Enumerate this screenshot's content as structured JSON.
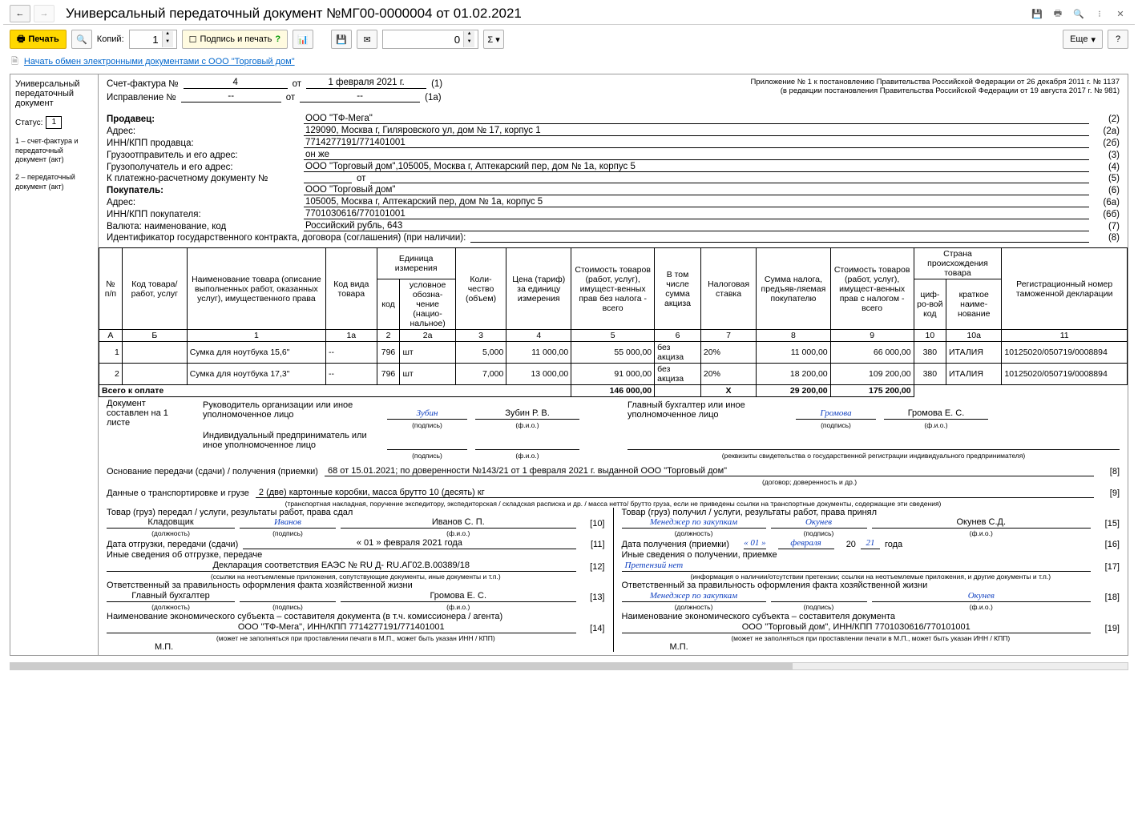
{
  "window": {
    "title": "Универсальный передаточный документ №МГ00-0000004 от 01.02.2021"
  },
  "toolbar": {
    "print": "Печать",
    "copies_label": "Копий:",
    "copies_value": "1",
    "sign_print": "Подпись и печать",
    "number_value": "0",
    "more": "Еще"
  },
  "edi_link": "Начать обмен электронными документами с ООО \"Торговый дом\"",
  "sidebar": {
    "title": "Универсальный передаточный документ",
    "status_label": "Статус:",
    "status_value": "1",
    "legend1": "1 – счет-фактура и передаточный документ (акт)",
    "legend2": "2 – передаточный документ (акт)"
  },
  "appendix": {
    "line1": "Приложение № 1 к постановлению Правительства Российской Федерации от 26 декабря 2011 г. № 1137",
    "line2": "(в редакции постановления Правительства Российской Федерации от 19 августа 2017 г. № 981)"
  },
  "header": {
    "invoice_label": "Счет-фактура №",
    "invoice_no": "4",
    "from": "от",
    "invoice_date": "1 февраля 2021 г.",
    "invoice_code": "(1)",
    "correction_label": "Исправление №",
    "correction_no": "--",
    "correction_date": "--",
    "correction_code": "(1а)"
  },
  "fields": {
    "seller_label": "Продавец:",
    "seller_val": "ООО \"ТФ-Мега\"",
    "seller_num": "(2)",
    "address_label": "Адрес:",
    "address_val": "129090, Москва г, Гиляровского ул, дом № 17, корпус 1",
    "address_num": "(2а)",
    "inn_seller_label": "ИНН/КПП продавца:",
    "inn_seller_val": "7714277191/771401001",
    "inn_seller_num": "(2б)",
    "shipper_label": "Грузоотправитель и его адрес:",
    "shipper_val": "он же",
    "shipper_num": "(3)",
    "consignee_label": "Грузополучатель и его адрес:",
    "consignee_val": "ООО \"Торговый дом\",105005, Москва г, Аптекарский пер, дом № 1а, корпус 5",
    "consignee_num": "(4)",
    "paydoc_label": "К платежно-расчетному документу №",
    "paydoc_val": "",
    "paydoc_from": "от",
    "paydoc_num": "(5)",
    "buyer_label": "Покупатель:",
    "buyer_val": "ООО \"Торговый дом\"",
    "buyer_num": "(6)",
    "buyer_addr_label": "Адрес:",
    "buyer_addr_val": "105005, Москва г, Аптекарский пер, дом № 1а, корпус 5",
    "buyer_addr_num": "(6а)",
    "inn_buyer_label": "ИНН/КПП покупателя:",
    "inn_buyer_val": "7701030616/770101001",
    "inn_buyer_num": "(6б)",
    "currency_label": "Валюта: наименование, код",
    "currency_val": "Российский рубль, 643",
    "currency_num": "(7)",
    "contract_label": "Идентификатор государственного контракта, договора (соглашения) (при наличии):",
    "contract_val": "",
    "contract_num": "(8)"
  },
  "table": {
    "headers": {
      "np": "№ п/п",
      "code": "Код товара/ работ, услуг",
      "name": "Наименование товара (описание выполненных работ, оказанных услуг), имущественного права",
      "type": "Код вида товара",
      "unit": "Единица измерения",
      "unit_code": "код",
      "unit_name": "условное обозна-чение (нацио-нальное)",
      "qty": "Коли-чество (объем)",
      "price": "Цена (тариф) за единицу измерения",
      "cost_excl": "Стоимость товаров (работ, услуг), имущест-венных прав без налога - всего",
      "excise": "В том числе сумма акциза",
      "rate": "Налоговая ставка",
      "tax": "Сумма налога, предъяв-ляемая покупателю",
      "cost_incl": "Стоимость товаров (работ, услуг), имущест-венных прав с налогом - всего",
      "country": "Страна происхождения товара",
      "country_code": "циф-ро-вой код",
      "country_name": "краткое наиме-нование",
      "decl": "Регистрационный номер таможенной декларации"
    },
    "subhead": [
      "А",
      "Б",
      "1",
      "1а",
      "2",
      "2а",
      "3",
      "4",
      "5",
      "6",
      "7",
      "8",
      "9",
      "10",
      "10а",
      "11"
    ],
    "rows": [
      {
        "np": "1",
        "code": "",
        "name": "Сумка для ноутбука 15,6\"",
        "type": "--",
        "ucode": "796",
        "uname": "шт",
        "qty": "5,000",
        "price": "11 000,00",
        "cost_excl": "55 000,00",
        "excise": "без акциза",
        "rate": "20%",
        "tax": "11 000,00",
        "cost_incl": "66 000,00",
        "ccode": "380",
        "cname": "ИТАЛИЯ",
        "decl": "10125020/050719/0008894"
      },
      {
        "np": "2",
        "code": "",
        "name": "Сумка для ноутбука 17,3\"",
        "type": "--",
        "ucode": "796",
        "uname": "шт",
        "qty": "7,000",
        "price": "13 000,00",
        "cost_excl": "91 000,00",
        "excise": "без акциза",
        "rate": "20%",
        "tax": "18 200,00",
        "cost_incl": "109 200,00",
        "ccode": "380",
        "cname": "ИТАЛИЯ",
        "decl": "10125020/050719/0008894"
      }
    ],
    "total_label": "Всего к оплате",
    "totals": {
      "cost_excl": "146 000,00",
      "excise": "Х",
      "tax": "29 200,00",
      "cost_incl": "175 200,00"
    }
  },
  "sheets": {
    "label": "Документ составлен на 1 листе"
  },
  "sig": {
    "director_label": "Руководитель организации или иное уполномоченное лицо",
    "director_sign": "Зубин",
    "director_name": "Зубин Р. В.",
    "accountant_label": "Главный бухгалтер или иное уполномоченное лицо",
    "accountant_sign": "Громова",
    "accountant_name": "Громова Е. С.",
    "entrepreneur_label": "Индивидуальный предприниматель или иное уполномоченное лицо",
    "sign_note": "(подпись)",
    "name_note": "(ф.и.о.)",
    "req_note": "(реквизиты свидетельства о государственной  регистрации индивидуального предпринимателя)"
  },
  "basis": {
    "label": "Основание передачи (сдачи) / получения (приемки)",
    "value": "68 от 15.01.2021; по доверенности №143/21 от 1 февраля 2021 г. выданной ООО \"Торговый дом\"",
    "note": "(договор; доверенность и др.)",
    "num": "[8]"
  },
  "transport": {
    "label": "Данные о транспортировке и грузе",
    "value": "2 (две) картонные коробки, масса брутто 10 (десять) кг",
    "note": "(транспортная накладная, поручение экспедитору, экспедиторская / складская расписка и др. / масса нетто/ брутто груза, если не приведены ссылки на транспортные документы, содержащие эти сведения)",
    "num": "[9]"
  },
  "left": {
    "head": "Товар (груз) передал / услуги, результаты работ, права сдал",
    "pos": "Кладовщик",
    "sign": "Иванов",
    "name": "Иванов С. П.",
    "num10": "[10]",
    "date_label": "Дата отгрузки, передачи (сдачи)",
    "date_val": "« 01 »   февраля   2021   года",
    "num11": "[11]",
    "other_label": "Иные сведения об отгрузке, передаче",
    "other_val": "Декларация соответствия ЕАЭС № RU Д- RU.АГ02.В.00389/18",
    "num12": "[12]",
    "other_note": "(ссылки на неотъемлемые приложения, сопутствующие документы, иные документы и т.п.)",
    "resp_label": "Ответственный за правильность оформления факта хозяйственной жизни",
    "resp_pos": "Главный бухгалтер",
    "resp_name": "Громова Е. С.",
    "num13": "[13]",
    "entity_label": "Наименование экономического субъекта – составителя документа (в т.ч. комиссионера / агента)",
    "entity_val": "ООО \"ТФ-Мега\", ИНН/КПП 7714277191/771401001",
    "num14": "[14]",
    "entity_note": "(может не заполняться при проставлении печати в М.П., может быть указан ИНН / КПП)",
    "mp": "М.П."
  },
  "right": {
    "head": "Товар (груз) получил / услуги, результаты работ, права принял",
    "pos": "Менеджер по закупкам",
    "sign": "Окунев",
    "name": "Окунев С.Д.",
    "num15": "[15]",
    "date_label": "Дата получения (приемки)",
    "date_d": "« 01 »",
    "date_m": "февраля",
    "date_y2": "20",
    "date_y": "21",
    "date_sfx": "года",
    "num16": "[16]",
    "other_label": "Иные сведения о получении, приемке",
    "other_val": "Претензий нет",
    "num17": "[17]",
    "other_note": "(информация о наличии/отсутствии претензии; ссылки на неотъемлемые приложения, и другие  документы и т.п.)",
    "resp_label": "Ответственный за правильность оформления факта хозяйственной жизни",
    "resp_pos": "Менеджер по закупкам",
    "resp_sign": "Окунев",
    "num18": "[18]",
    "entity_label": "Наименование экономического субъекта – составителя документа",
    "entity_val": "ООО \"Торговый дом\", ИНН/КПП 7701030616/770101001",
    "num19": "[19]",
    "entity_note": "(может не заполняться при проставлении печати в М.П., может быть указан ИНН / КПП)",
    "mp": "М.П."
  },
  "notes": {
    "pos": "(должность)",
    "sign": "(подпись)",
    "name": "(ф.и.о.)"
  }
}
